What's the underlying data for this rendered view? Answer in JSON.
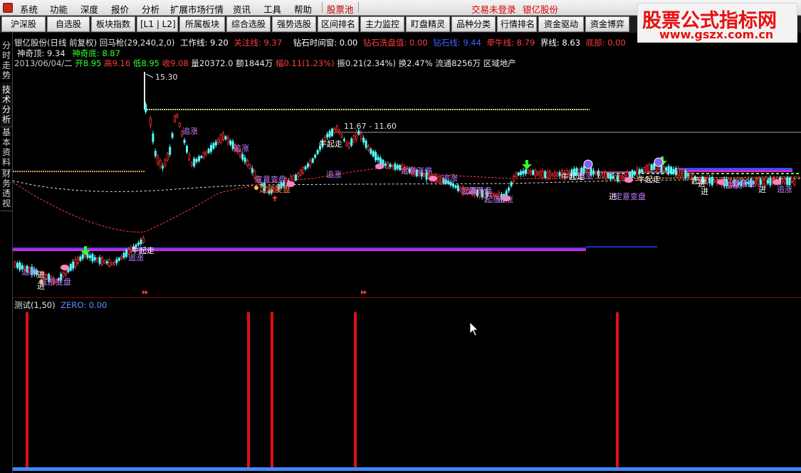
{
  "menubar": {
    "items": [
      "系统",
      "功能",
      "深度",
      "报价",
      "分析",
      "扩展市场行情",
      "资讯",
      "工具",
      "帮助"
    ],
    "stock_pool": "股票池",
    "status": "交易未登录",
    "stock_name": "银亿股份"
  },
  "toolbar": {
    "buttons": [
      "沪深股",
      "自选股",
      "板块指数",
      "[L1 | L2]",
      "所属板块",
      "综合选股",
      "强势选股",
      "区间排名",
      "主力监控",
      "盯盘精灵",
      "品种分类",
      "行情排名",
      "资金驱动",
      "资金博弈"
    ]
  },
  "watermark": {
    "title": "股票公式指标网",
    "url": "www.gszx.com.cn"
  },
  "side_tabs": [
    "分时走势",
    "技术分析",
    "基本资料",
    "财务透视"
  ],
  "info": {
    "line1": {
      "title": "银亿股份(日线 前复权) 回马枪(29,240,2,0)",
      "work_line": "工作线: 9.20",
      "attention_line": "关注线: 9.37",
      "diamond_window": "钻石时间窗: 0.00",
      "diamond_wash": "钻石洗盘值: 0.00",
      "diamond_line": "钻石线: 9.44",
      "bull_line": "牵牛线: 8.79",
      "boundary_line": "界线: 8.63",
      "bottom": "底部: 0.00"
    },
    "line2": {
      "top": "神奇顶: 9.34",
      "bottom": "神奇底: 8.87"
    },
    "line3": {
      "date": "2013/06/04/二",
      "open": "开8.95",
      "high": "高9.16",
      "low": "低8.95",
      "close": "收9.08",
      "volume": "量20372.0",
      "amount": "额1844万",
      "change": "幅0.11(1.23%)",
      "amplitude": "振0.21(2.34%)",
      "turnover": "换2.47%",
      "float": "流通8256万",
      "region": "区域地产"
    }
  },
  "chart": {
    "high_label": "15.30",
    "range_label": "11.67 - 11.60",
    "annotations": [
      "追涨",
      "追涨",
      "牛起走",
      "追涨",
      "牛起走",
      "追涨",
      "追涨",
      "进",
      "追涨",
      "进",
      "追涨",
      "起涨",
      "进",
      "起涨",
      "追涨",
      "进",
      "追涨",
      "起涨",
      "进",
      "追涨",
      "进"
    ],
    "text_marks": [
      "底部变盘",
      "底意变盘",
      "定意涨停",
      "定意变盘",
      "定意变盘",
      "震荡盘",
      "震荡盘",
      "牛起走",
      "牛起走"
    ],
    "colors": {
      "candle_up": "#ff3030",
      "candle_down": "#54ffff",
      "bull_line": "#ff3a3a",
      "work_line": "#e8e8e8",
      "magenta_band": "#e020c8",
      "blue_band": "#3050ff",
      "annotation": "#c080ff",
      "indicator_bar": "#e01010",
      "zero_line": "#3a8cff"
    }
  },
  "indicator": {
    "title": "测试(1,50)",
    "zero": "ZERO: 0.00"
  }
}
